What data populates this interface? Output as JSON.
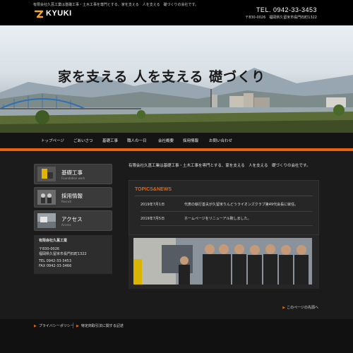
{
  "header": {
    "tagline": "有限会社久菖工業は基礎工事・土木工事を専門とする、家を支える　人を支える　礎づくりの会社です。",
    "logo_text": "KYUKI",
    "tel": "TEL. 0942-33-3453",
    "address": "〒830-0026　福岡県久留米市長門石町1322"
  },
  "hero": {
    "copy": "家を支える 人を支える 礎づくり"
  },
  "nav": {
    "items": [
      "トップページ",
      "ごあいさつ",
      "基礎工事",
      "職人の一日",
      "会社概要",
      "採用情報",
      "お問い合わせ"
    ]
  },
  "sidebar": {
    "cards": [
      {
        "title": "基礎工事",
        "sub": "Foundation work"
      },
      {
        "title": "採用情報",
        "sub": "Recruit"
      },
      {
        "title": "アクセス",
        "sub": "Access"
      }
    ],
    "company": {
      "name": "有限会社久菖工業",
      "postal": "〒830-0026",
      "address": "福岡県久留米市長門石町1322",
      "tel": "TEL 0942-33-3453",
      "fax": "FAX 0942-33-3466"
    }
  },
  "main": {
    "intro": "有限会社久菖工業は基礎工事・土木工事を専門とする、家を支える　人を支える　礎づくりの会社です。",
    "topics_title": "TOPICS&NEWS",
    "news": [
      {
        "date": "2019年7月1日",
        "text": "代表の執行善夫が久留米りんどうライオンズクラブ第49代会長に就任。"
      },
      {
        "date": "2019年7月5日",
        "text": "ホームページをリニューアル致しました。"
      }
    ],
    "page_top": "このページの先頭へ"
  },
  "footer": {
    "links": [
      "プライバシーポリシー",
      "特定商取引法に関する記述"
    ]
  },
  "colors": {
    "accent": "#e8640c",
    "background": "#1b1b1b"
  }
}
